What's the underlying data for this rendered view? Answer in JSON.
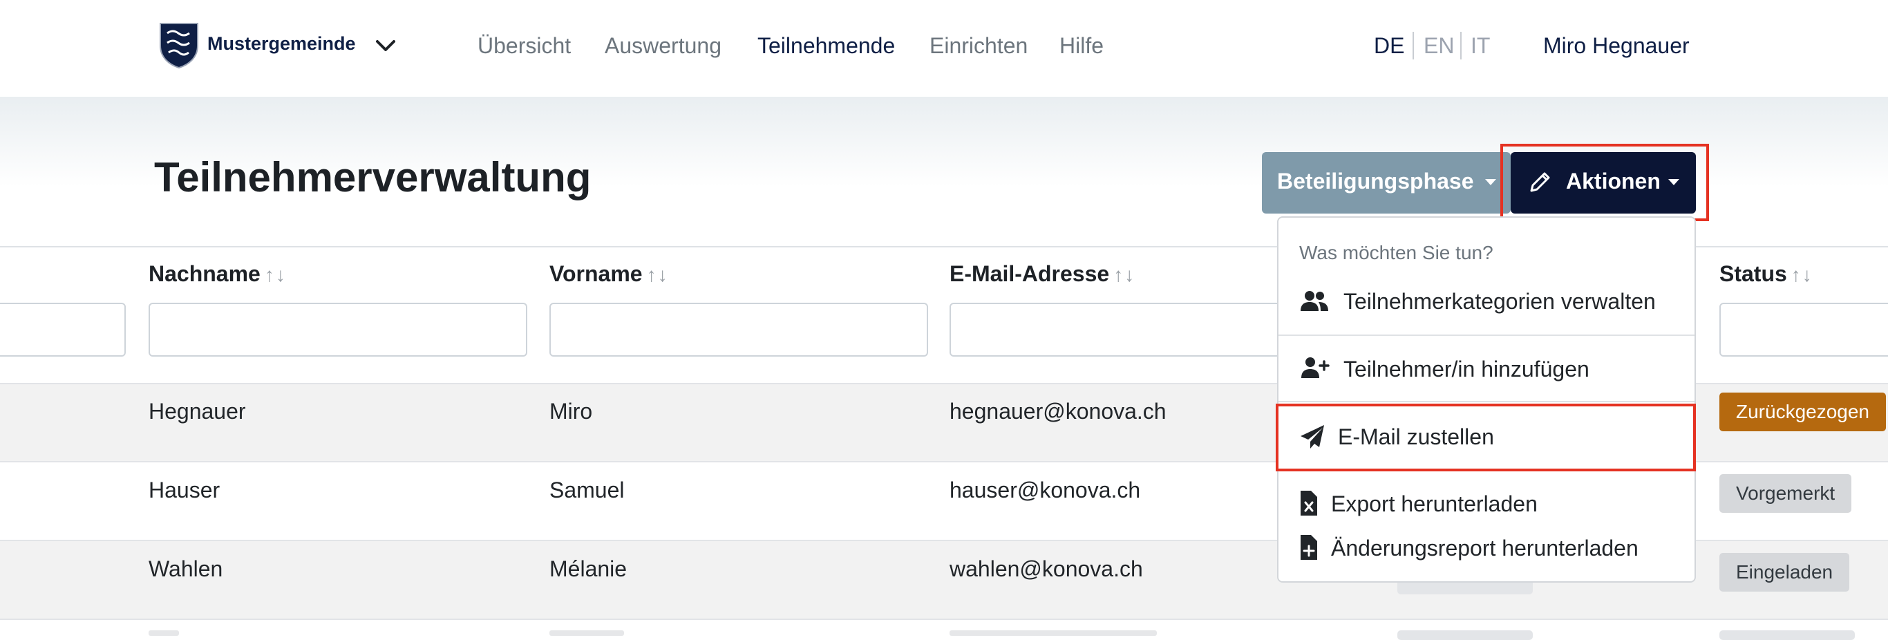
{
  "header": {
    "brand": "Mustergemeinde",
    "nav": [
      "Übersicht",
      "Auswertung",
      "Teilnehmende",
      "Einrichten",
      "Hilfe"
    ],
    "active_nav": "Teilnehmende",
    "languages": [
      "DE",
      "EN",
      "IT"
    ],
    "active_language": "DE",
    "user_name": "Miro Hegnauer"
  },
  "page": {
    "title": "Teilnehmerverwaltung",
    "phase_button": "Beteiligungsphase",
    "actions_button": "Aktionen"
  },
  "table": {
    "columns": [
      "Nachname",
      "Vorname",
      "E-Mail-Adresse",
      "Status"
    ],
    "sort_glyph": "↑↓",
    "rows": [
      {
        "last": "Hegnauer",
        "first": "Miro",
        "email": "hegnauer@konova.ch",
        "status": "Zurückgezogen",
        "status_color": "#b5690f"
      },
      {
        "last": "Hauser",
        "first": "Samuel",
        "email": "hauser@konova.ch",
        "status": "Vorgemerkt",
        "status_color": "#d6d8db"
      },
      {
        "last": "Wahlen",
        "first": "Mélanie",
        "email": "wahlen@konova.ch",
        "status": "Eingeladen",
        "status_color": "#d6d8db"
      }
    ]
  },
  "dropdown": {
    "header": "Was möchten Sie tun?",
    "items": [
      {
        "label": "Teilnehmerkategorien verwalten",
        "icon": "users-icon"
      },
      {
        "label": "Teilnehmer/in hinzufügen",
        "icon": "user-plus-icon"
      },
      {
        "label": "E-Mail zustellen",
        "icon": "paper-plane-icon"
      },
      {
        "label": "Export herunterladen",
        "icon": "file-excel-icon"
      },
      {
        "label": "Änderungsreport herunterladen",
        "icon": "file-plus-icon"
      }
    ]
  },
  "colors": {
    "brand": "#0f1f45",
    "phase_button": "#7f9aaa",
    "actions_button": "#0b1535",
    "highlight": "#e53222",
    "withdrawn": "#b5690f"
  }
}
